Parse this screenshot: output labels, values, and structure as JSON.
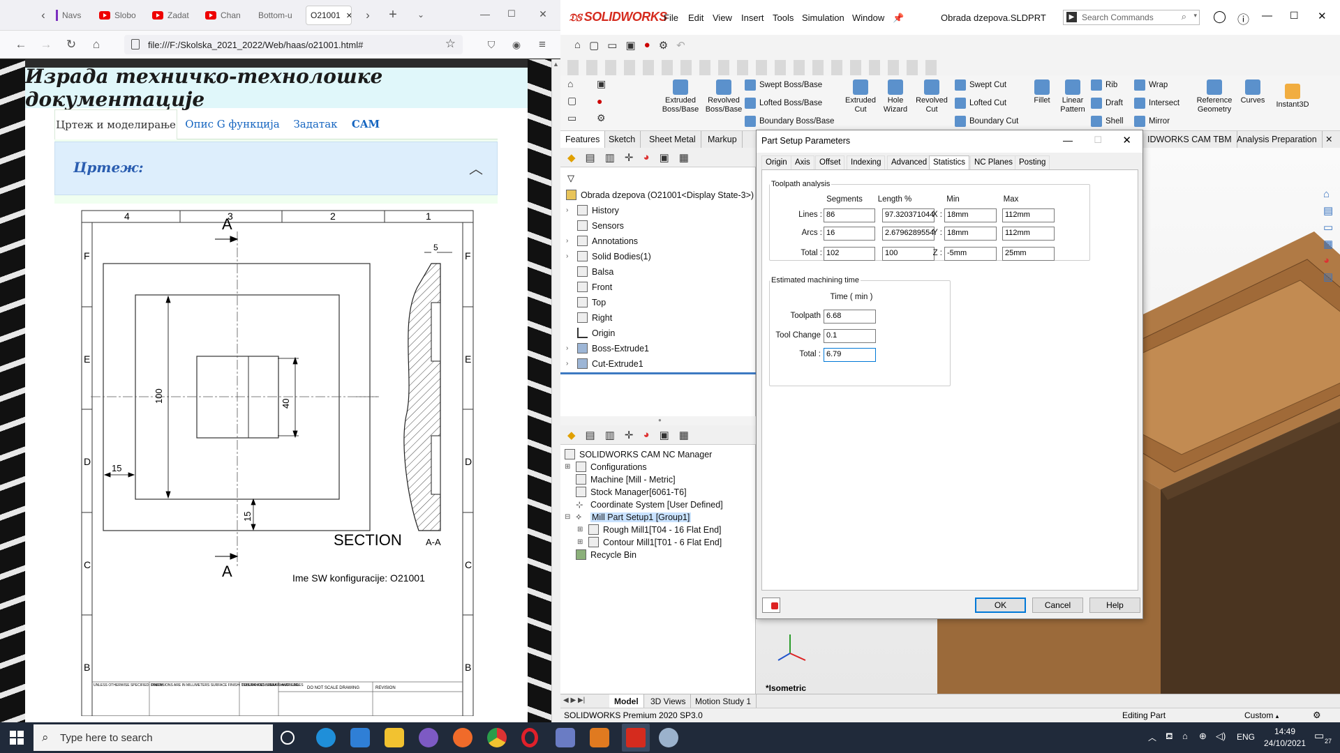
{
  "browser": {
    "tabs": [
      "Navs",
      "Slobo",
      "Zadat",
      "Chan",
      "Bottom-u",
      "O21001"
    ],
    "url": "file:///F:/Skolska_2021_2022/Web/haas/o21001.html#",
    "page": {
      "title": "Израда техничко-технолошке документације",
      "tabs": [
        "Цртеж и моделирање",
        "Опис G функција",
        "Задатак",
        "CAM"
      ],
      "section_title": "Цртеж:",
      "drawing": {
        "col_labels": [
          "4",
          "3",
          "2",
          "1"
        ],
        "row_labels": [
          "F",
          "E",
          "D",
          "C",
          "B"
        ],
        "section_letter": "A",
        "dim_100": "100",
        "dim_40": "40",
        "dim_15_left": "15",
        "dim_15_bottom": "15",
        "dim_5": "5",
        "section_label": "SECTION",
        "section_suffix": "A-A",
        "config_label": "Ime SW konfiguracije: O21001",
        "tb_col1": "UNLESS OTHERWISE SPECIFIED: DIMENSIONS ARE IN MILLIMETERS SURFACE FINISH: TOLERANCES: LINEAR: ANGULAR:",
        "tb_col2": "FINISH:",
        "tb_col3": "DEBURR AND BREAK SHARP EDGES",
        "tb_col4": "DO NOT SCALE DRAWING",
        "tb_col5": "REVISION"
      }
    }
  },
  "solidworks": {
    "logo": "SOLIDWORKS",
    "menu": [
      "File",
      "Edit",
      "View",
      "Insert",
      "Tools",
      "Simulation",
      "Window"
    ],
    "document": "Obrada dzepova.SLDPRT",
    "search_placeholder": "Search Commands",
    "ribbon": {
      "big": [
        "Extruded Boss/Base",
        "Revolved Boss/Base",
        "Extruded Cut",
        "Hole Wizard",
        "Revolved Cut",
        "Fillet",
        "Linear Pattern",
        "Reference Geometry",
        "Curves",
        "Instant3D"
      ],
      "small": [
        "Swept Boss/Base",
        "Lofted Boss/Base",
        "Boundary Boss/Base",
        "Swept Cut",
        "Lofted Cut",
        "Boundary Cut",
        "Rib",
        "Draft",
        "Shell",
        "Wrap",
        "Intersect",
        "Mirror"
      ]
    },
    "cm_tabs": [
      "Features",
      "Sketch",
      "Sheet Metal",
      "Markup"
    ],
    "cm_tabs_right": [
      "IDWORKS CAM TBM",
      "Analysis Preparation"
    ],
    "feature_tree": [
      "Obrada dzepova  (O21001<Display State-3>)",
      "History",
      "Sensors",
      "Annotations",
      "Solid Bodies(1)",
      "Balsa",
      "Front",
      "Top",
      "Right",
      "Origin",
      "Boss-Extrude1",
      "Cut-Extrude1"
    ],
    "cam_tree": [
      "SOLIDWORKS CAM NC Manager",
      "Configurations",
      "Machine [Mill - Metric]",
      "Stock Manager[6061-T6]",
      "Coordinate System [User Defined]",
      "Mill Part Setup1 [Group1]",
      "Rough Mill1[T04 - 16 Flat End]",
      "Contour Mill1[T01 - 6 Flat End]",
      "Recycle Bin"
    ],
    "view_label": "*Isometric",
    "bottom_tabs": [
      "Model",
      "3D Views",
      "Motion Study 1"
    ],
    "status": {
      "left": "SOLIDWORKS Premium 2020 SP3.0",
      "mode": "Editing Part",
      "units": "Custom"
    }
  },
  "dialog": {
    "title": "Part Setup Parameters",
    "tabs": [
      "Origin",
      "Axis",
      "Offset",
      "Indexing",
      "Advanced",
      "Statistics",
      "NC Planes",
      "Posting"
    ],
    "toolpath": {
      "legend": "Toolpath analysis",
      "col_segments": "Segments",
      "col_length": "Length %",
      "col_min": "Min",
      "col_max": "Max",
      "rows": [
        {
          "label": "Lines :",
          "segments": "86",
          "length": "97.320371044",
          "axis": "X :",
          "min": "18mm",
          "max": "112mm"
        },
        {
          "label": "Arcs :",
          "segments": "16",
          "length": "2.6796289554",
          "axis": "Y :",
          "min": "18mm",
          "max": "112mm"
        },
        {
          "label": "Total :",
          "segments": "102",
          "length": "100",
          "axis": "Z :",
          "min": "-5mm",
          "max": "25mm"
        }
      ]
    },
    "time": {
      "legend": "Estimated machining time",
      "col": "Time ( min )",
      "rows": [
        {
          "label": "Toolpath",
          "value": "6.68"
        },
        {
          "label": "Tool Change",
          "value": "0.1"
        },
        {
          "label": "Total :",
          "value": "6.79"
        }
      ]
    },
    "buttons": {
      "ok": "OK",
      "cancel": "Cancel",
      "help": "Help"
    }
  },
  "taskbar": {
    "search_placeholder": "Type here to search",
    "lang": "ENG",
    "time": "14:49",
    "date": "24/10/2021",
    "notifications": "27"
  }
}
